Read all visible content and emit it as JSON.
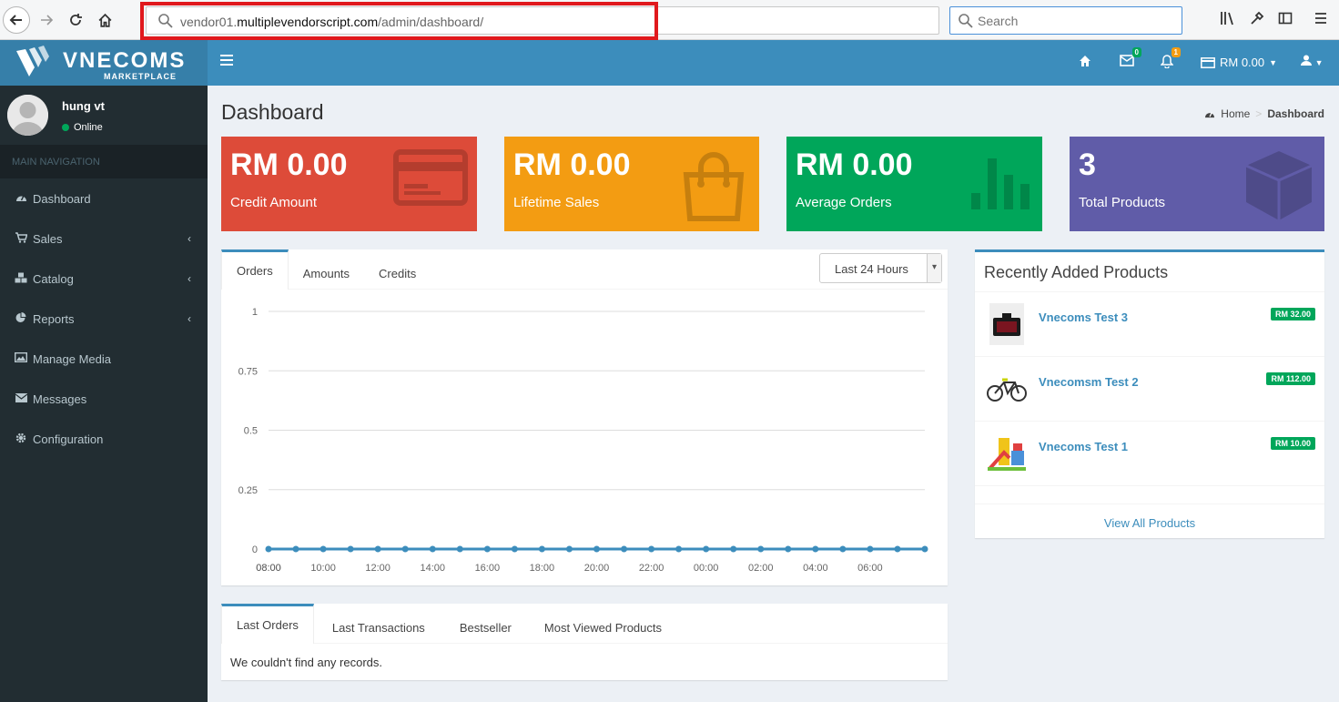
{
  "browser": {
    "url_prefix": "vendor01.",
    "url_domain": "multiplevendorscript.com",
    "url_path": "/admin/dashboard/",
    "search_placeholder": "Search"
  },
  "brand": {
    "title": "VNECOMS",
    "subtitle": "MARKETPLACE"
  },
  "header": {
    "mail_count": "0",
    "notification_count": "1",
    "wallet": "RM 0.00"
  },
  "user": {
    "name": "hung vt",
    "status": "Online"
  },
  "sidebar": {
    "header": "MAIN NAVIGATION",
    "items": [
      {
        "label": "Dashboard",
        "icon": "dashboard-icon"
      },
      {
        "label": "Sales",
        "icon": "cart-icon"
      },
      {
        "label": "Catalog",
        "icon": "cubes-icon"
      },
      {
        "label": "Reports",
        "icon": "pie-chart-icon"
      },
      {
        "label": "Manage Media",
        "icon": "image-icon"
      },
      {
        "label": "Messages",
        "icon": "envelope-icon"
      },
      {
        "label": "Configuration",
        "icon": "gear-icon"
      }
    ]
  },
  "page": {
    "title": "Dashboard",
    "breadcrumb_home": "Home",
    "breadcrumb_current": "Dashboard"
  },
  "stats": [
    {
      "value": "RM 0.00",
      "label": "Credit Amount",
      "color": "#dd4b39"
    },
    {
      "value": "RM 0.00",
      "label": "Lifetime Sales",
      "color": "#f39c12"
    },
    {
      "value": "RM 0.00",
      "label": "Average Orders",
      "color": "#00a65a"
    },
    {
      "value": "3",
      "label": "Total Products",
      "color": "#605ca8"
    }
  ],
  "chart_box": {
    "tabs": [
      "Orders",
      "Amounts",
      "Credits"
    ],
    "period": "Last 24 Hours"
  },
  "chart_data": {
    "type": "line",
    "x": [
      "08:00",
      "09:00",
      "10:00",
      "11:00",
      "12:00",
      "13:00",
      "14:00",
      "15:00",
      "16:00",
      "17:00",
      "18:00",
      "19:00",
      "20:00",
      "21:00",
      "22:00",
      "23:00",
      "00:00",
      "01:00",
      "02:00",
      "03:00",
      "04:00",
      "05:00",
      "06:00",
      "07:00",
      "08:00"
    ],
    "x_tick_labels": [
      "08:00",
      "10:00",
      "12:00",
      "14:00",
      "16:00",
      "18:00",
      "20:00",
      "22:00",
      "00:00",
      "02:00",
      "04:00",
      "06:00",
      "08:00"
    ],
    "series": [
      {
        "values": [
          0,
          0,
          0,
          0,
          0,
          0,
          0,
          0,
          0,
          0,
          0,
          0,
          0,
          0,
          0,
          0,
          0,
          0,
          0,
          0,
          0,
          0,
          0,
          0,
          0
        ],
        "color": "#3c8dbc"
      }
    ],
    "y_ticks": [
      "1",
      "0.75",
      "0.5",
      "0.25",
      "0"
    ],
    "ylim": [
      0,
      1
    ],
    "grid": true
  },
  "recent": {
    "title": "Recently Added Products",
    "products": [
      {
        "name": "Vnecoms Test 3",
        "price": "RM 32.00"
      },
      {
        "name": "Vnecomsm Test 2",
        "price": "RM 112.00"
      },
      {
        "name": "Vnecoms Test 1",
        "price": "RM 10.00"
      }
    ],
    "view_all": "View All Products"
  },
  "orders_box": {
    "tabs": [
      "Last Orders",
      "Last Transactions",
      "Bestseller",
      "Most Viewed Products"
    ],
    "empty": "We couldn't find any records."
  }
}
